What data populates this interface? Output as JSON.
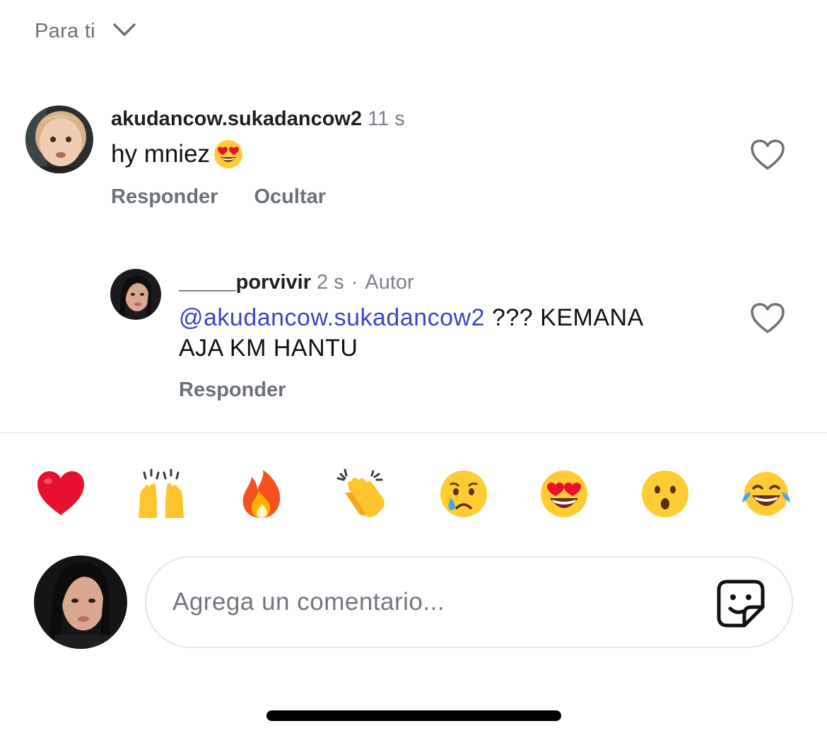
{
  "header": {
    "sort_label": "Para ti"
  },
  "comments": [
    {
      "username": "akudancow.sukadancow2",
      "time": "11 s",
      "text": "hy mniez",
      "text_emoji": "heart-eyes",
      "actions": [
        "Responder",
        "Ocultar"
      ]
    }
  ],
  "reply": {
    "username": "_____porvivir",
    "time": "2 s",
    "separator": "·",
    "badge": "Autor",
    "mention": "@akudancow.sukadancow2",
    "text": " ??? KEMANA AJA KM HANTU",
    "action": "Responder"
  },
  "emoji_bar": [
    "red-heart",
    "raising-hands",
    "fire",
    "clapping-hands",
    "crying-face",
    "heart-eyes",
    "open-mouth-face",
    "tears-of-joy"
  ],
  "composer": {
    "placeholder": "Agrega un comentario..."
  },
  "colors": {
    "mention": "#3b46c9",
    "muted": "#6b717a",
    "heart": "#e8112d",
    "emoji_yellow": "#ffcc33"
  }
}
